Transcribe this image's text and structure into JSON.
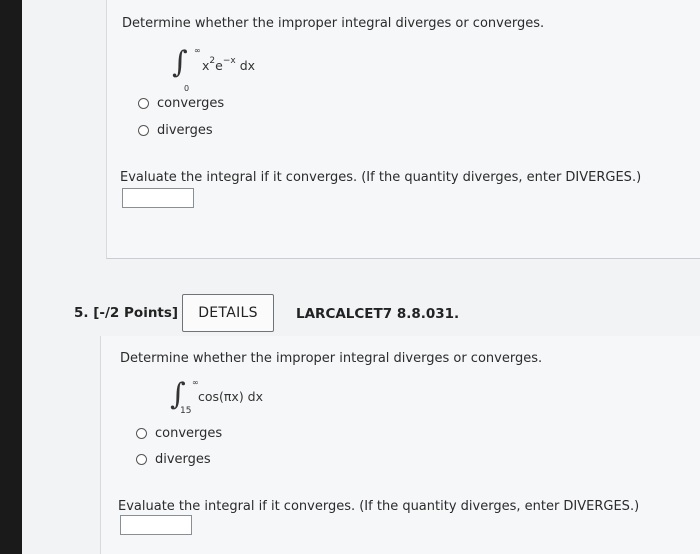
{
  "problem4": {
    "question": "Determine whether the improper integral diverges or converges.",
    "integral": {
      "lower": "0",
      "upper": "∞",
      "expression": "x²e⁻ˣ dx",
      "base": "x",
      "exp1": "2",
      "base2": "e",
      "exp2": "−x",
      "dx": " dx"
    },
    "options": [
      "converges",
      "diverges"
    ],
    "evaluate_prompt": "Evaluate the integral if it converges. (If the quantity diverges, enter DIVERGES.)",
    "answer_value": ""
  },
  "problem5": {
    "number_label": "5.  [-/2 Points]",
    "details_label": "DETAILS",
    "reference": "LARCALCET7 8.8.031.",
    "question": "Determine whether the improper integral diverges or converges.",
    "integral": {
      "lower": "15",
      "upper": "∞",
      "expression": "cos(πx) dx"
    },
    "options": [
      "converges",
      "diverges"
    ],
    "evaluate_prompt": "Evaluate the integral if it converges. (If the quantity diverges, enter DIVERGES.)",
    "answer_value": ""
  }
}
